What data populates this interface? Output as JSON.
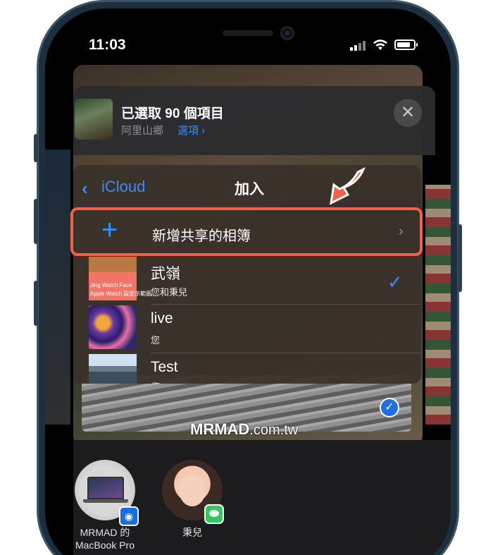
{
  "status_bar": {
    "time": "11:03"
  },
  "share_header": {
    "title": "已選取 90 個項目",
    "subtitle": "阿里山鄉",
    "options_label": "選項 ›",
    "close_glyph": "✕"
  },
  "album_panel": {
    "back_label": "iCloud",
    "title": "加入",
    "new_album": {
      "icon": "plus-icon",
      "label": "新增共享的相簿"
    },
    "albums": [
      {
        "name": "武嶺",
        "subtitle": "您和秉兒",
        "thumb_text_1": "Jing Watch Face",
        "thumb_text_2": "Apple Watch 設定示範圖",
        "checked": true
      },
      {
        "name": "live",
        "subtitle": "您",
        "checked": false
      },
      {
        "name": "Test",
        "subtitle": "您",
        "checked": false
      }
    ]
  },
  "watermark": {
    "brand": "MRMAD",
    "domain": ".com.tw"
  },
  "airdrop": {
    "contacts": [
      {
        "name_line_1": "MRMAD 的",
        "name_line_2": "MacBook Pro",
        "badge": "airdrop-icon"
      },
      {
        "name_line_1": "秉兒",
        "badge": "messages-icon"
      }
    ]
  },
  "colors": {
    "accent_blue": "#3a8df5",
    "highlight_red": "#f5604c",
    "messages_green": "#34c759"
  }
}
